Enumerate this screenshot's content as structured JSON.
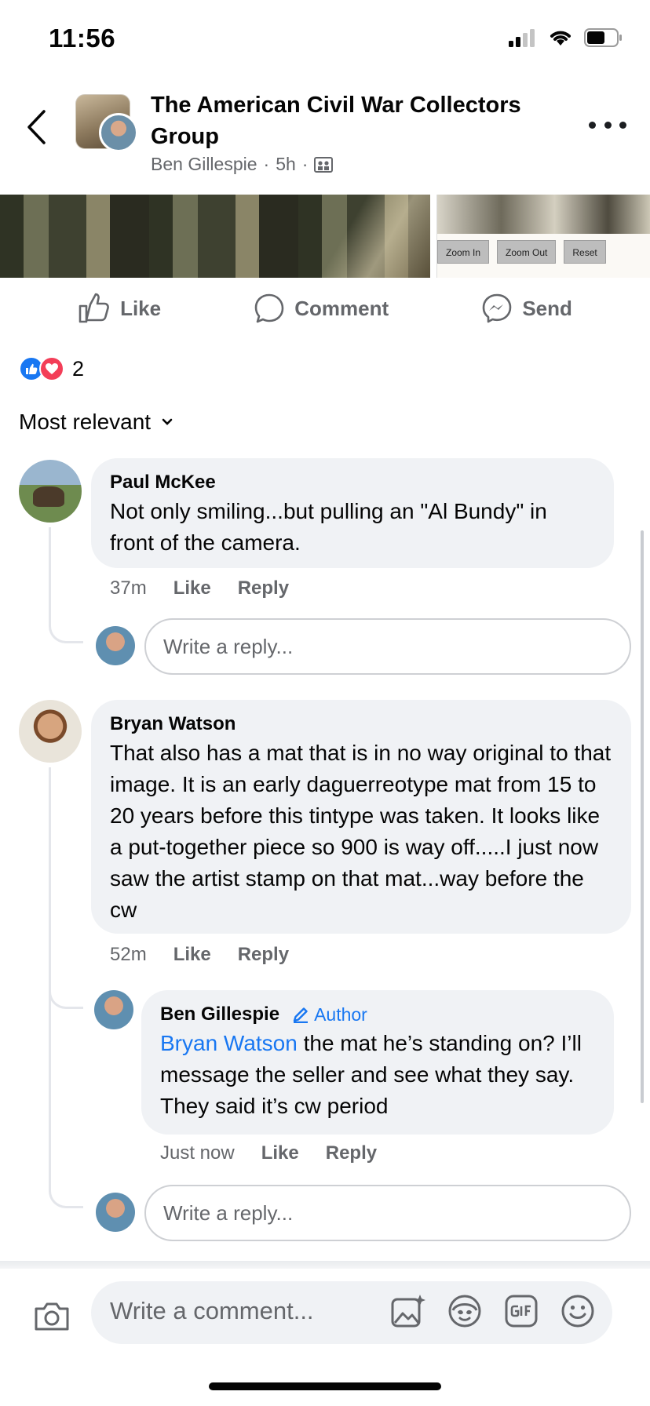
{
  "status": {
    "time": "11:56"
  },
  "header": {
    "group_title": "The American Civil War Collectors Group",
    "author": "Ben Gillespie",
    "age": "5h",
    "separator": "·"
  },
  "photo": {
    "zoom_in": "Zoom In",
    "zoom_out": "Zoom Out",
    "reset": "Reset"
  },
  "actions": {
    "like": "Like",
    "comment": "Comment",
    "send": "Send"
  },
  "reactions": {
    "count": "2"
  },
  "sort": {
    "label": "Most relevant"
  },
  "comments": [
    {
      "name": "Paul McKee",
      "text": "Not only smiling...but pulling an \"Al Bundy\" in front of the camera.",
      "time": "37m",
      "like": "Like",
      "reply": "Reply",
      "reply_placeholder": "Write a reply..."
    },
    {
      "name": "Bryan Watson",
      "text": "That also has a mat that is in no way original to that image.  It is an early daguerreotype mat from 15 to 20 years before this tintype was taken.  It looks like a put-together piece so 900 is way off.....I just now saw the artist stamp on that mat...way before the cw",
      "time": "52m",
      "like": "Like",
      "reply": "Reply",
      "reply_placeholder": "Write a reply..."
    }
  ],
  "reply": {
    "name": "Ben Gillespie",
    "badge": "Author",
    "mention": "Bryan Watson",
    "text": " the mat he’s standing on? I’ll message the seller and see what they say. They said it’s cw period",
    "time": "Just now",
    "like": "Like",
    "reply": "Reply"
  },
  "composer": {
    "placeholder": "Write a comment..."
  },
  "colors": {
    "accent": "#1877f2",
    "love": "#f33e58",
    "bubble": "#f0f2f5",
    "muted": "#65676b"
  }
}
